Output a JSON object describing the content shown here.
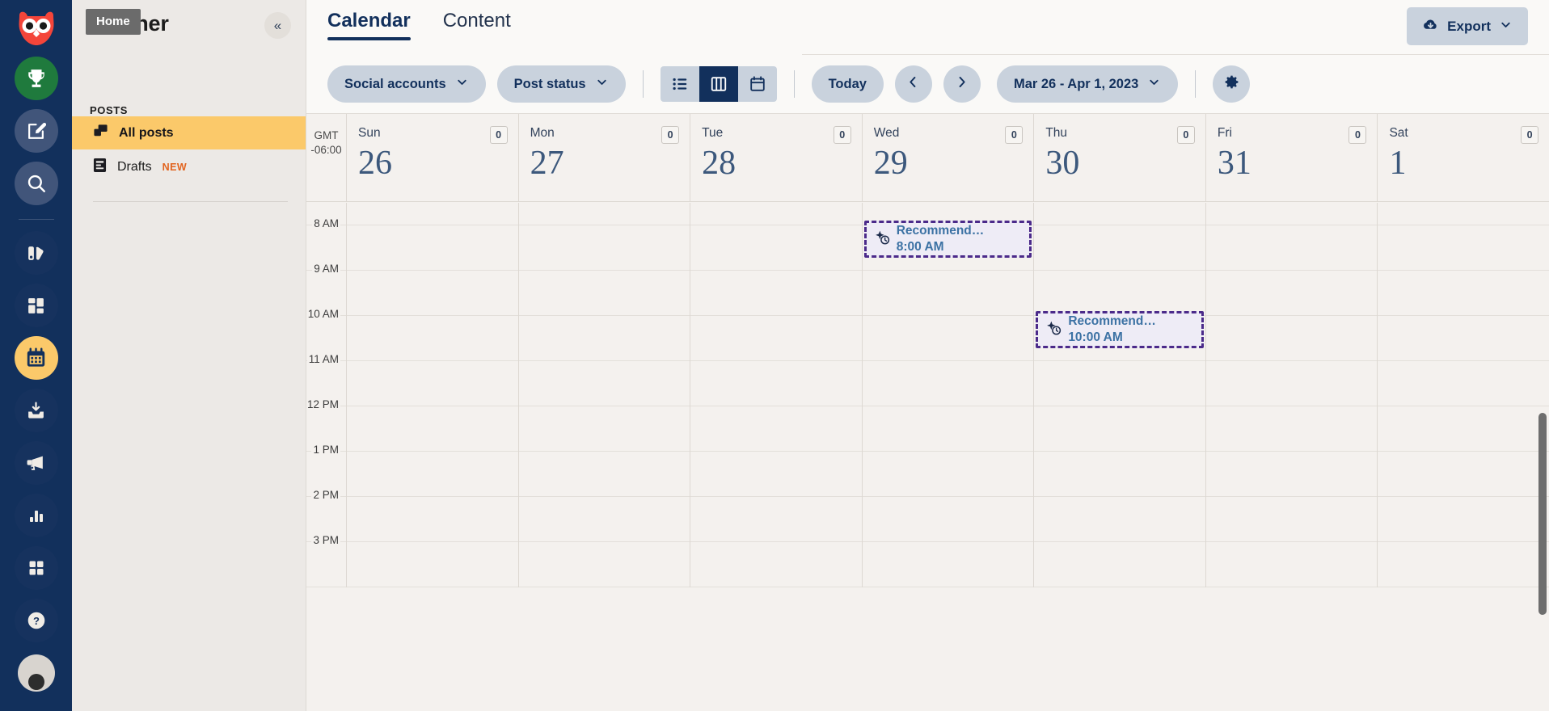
{
  "rail": {
    "items": [
      {
        "name": "owl-logo-icon",
        "label": "Hootsuite"
      },
      {
        "name": "trophy-icon",
        "label": "Achievements"
      },
      {
        "name": "compose-icon",
        "label": "Create"
      },
      {
        "name": "search-icon",
        "label": "Search"
      },
      {
        "name": "streams-icon",
        "label": "Streams"
      },
      {
        "name": "inbox-grid-icon",
        "label": "Inbox"
      },
      {
        "name": "calendar-icon",
        "label": "Planner"
      },
      {
        "name": "content-tray-icon",
        "label": "Content"
      },
      {
        "name": "megaphone-icon",
        "label": "Advertise"
      },
      {
        "name": "analytics-bars-icon",
        "label": "Analytics"
      },
      {
        "name": "apps-grid-icon",
        "label": "Apps"
      },
      {
        "name": "help-question-icon",
        "label": "Help"
      },
      {
        "name": "user-avatar",
        "label": "Profile"
      }
    ],
    "active_index": 6
  },
  "panel": {
    "title": "Planner",
    "tooltip": "Home",
    "collapse_icon": "«",
    "section_label": "POSTS",
    "items": [
      {
        "label": "All posts",
        "icon": "copy-stack-icon",
        "active": true,
        "badge": ""
      },
      {
        "label": "Drafts",
        "icon": "document-lines-icon",
        "active": false,
        "badge": "NEW"
      }
    ]
  },
  "topbar": {
    "tabs": [
      {
        "label": "Calendar",
        "active": true
      },
      {
        "label": "Content",
        "active": false
      }
    ],
    "export_label": "Export",
    "export_icon": "cloud-download-icon",
    "export_caret": "chevron-down-icon"
  },
  "filterbar": {
    "social_accounts_label": "Social accounts",
    "post_status_label": "Post status",
    "views": [
      {
        "name": "list-view-icon",
        "active": false
      },
      {
        "name": "week-columns-view-icon",
        "active": true
      },
      {
        "name": "month-calendar-view-icon",
        "active": false
      }
    ],
    "today_label": "Today",
    "prev_icon": "chevron-left-icon",
    "next_icon": "chevron-right-icon",
    "date_range_label": "Mar 26 - Apr 1, 2023",
    "settings_icon": "gear-icon"
  },
  "calendar": {
    "timezone_line1": "GMT",
    "timezone_line2": "-06:00",
    "days": [
      {
        "name": "Sun",
        "num": "26",
        "count": "0"
      },
      {
        "name": "Mon",
        "num": "27",
        "count": "0"
      },
      {
        "name": "Tue",
        "num": "28",
        "count": "0"
      },
      {
        "name": "Wed",
        "num": "29",
        "count": "0"
      },
      {
        "name": "Thu",
        "num": "30",
        "count": "0"
      },
      {
        "name": "Fri",
        "num": "31",
        "count": "0"
      },
      {
        "name": "Sat",
        "num": "1",
        "count": "0"
      }
    ],
    "time_labels": [
      "8 AM",
      "9 AM",
      "10 AM",
      "11 AM",
      "12 PM",
      "1 PM",
      "2 PM",
      "3 PM"
    ],
    "events": [
      {
        "day_index": 3,
        "title": "Recommend…",
        "time": "8:00 AM",
        "icon": "sparkle-clock-icon",
        "border_color": "#4b2a8a",
        "fill_color": "#eeecf6",
        "text_color": "#3c72a4"
      },
      {
        "day_index": 4,
        "title": "Recommend…",
        "time": "10:00 AM",
        "icon": "sparkle-clock-icon",
        "border_color": "#4b2a8a",
        "fill_color": "#eeecf6",
        "text_color": "#3c72a4"
      }
    ]
  },
  "colors": {
    "rail_bg": "#12305c",
    "panel_bg": "#ece9e6",
    "accent_yellow": "#fbc96a",
    "navy": "#12305c",
    "pill_bg": "#c9d2dd",
    "new_badge": "#e2641f",
    "grid_bg": "#f4f1ee"
  }
}
